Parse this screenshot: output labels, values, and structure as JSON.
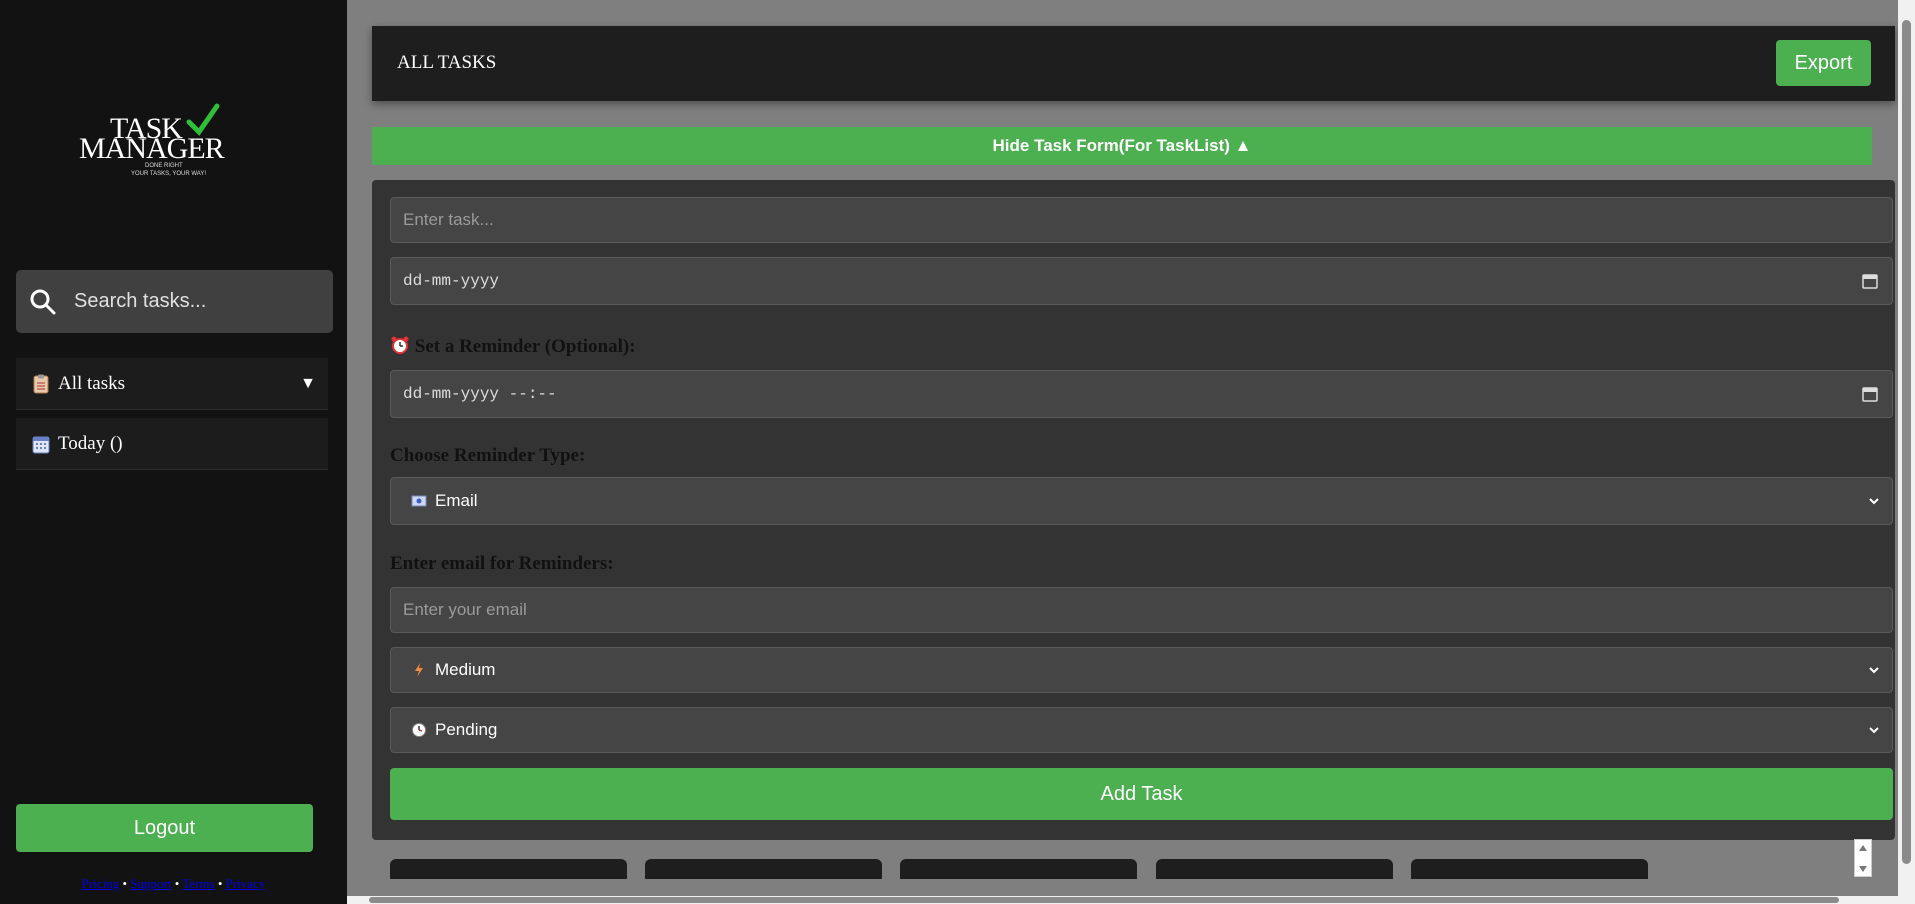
{
  "sidebar": {
    "logo": {
      "line1": "TASK",
      "line2": "MANAGER",
      "tagline1": "DONE RIGHT",
      "tagline2": "YOUR TASKS, YOUR WAY!"
    },
    "search_placeholder": "Search tasks...",
    "nav": [
      {
        "label": "All tasks",
        "icon": "clipboard-icon"
      },
      {
        "label": "Today ()",
        "icon": "calendar-icon"
      }
    ],
    "logout_label": "Logout",
    "footer": {
      "links": [
        "Pricing",
        "Support",
        "Terms",
        "Privacy"
      ],
      "separator": "•"
    }
  },
  "header": {
    "title": "ALL TASKS",
    "export_label": "Export"
  },
  "form_toggle": "Hide Task Form(For TaskList) ▲",
  "form": {
    "task_placeholder": "Enter task...",
    "date_value": "dd-mm-yyyy",
    "reminder_label": "Set a Reminder (Optional):",
    "reminder_value": "dd-mm-yyyy --:--",
    "reminder_type_label": "Choose Reminder Type:",
    "reminder_type_selected": "Email",
    "email_label": "Enter email for Reminders:",
    "email_placeholder": "Enter your email",
    "priority_selected": "Medium",
    "status_selected": "Pending",
    "add_label": "Add Task"
  },
  "colors": {
    "accent": "#4caf50",
    "sidebar_bg": "#121212",
    "panel_bg": "#333333",
    "page_bg": "#7f7f7f"
  }
}
